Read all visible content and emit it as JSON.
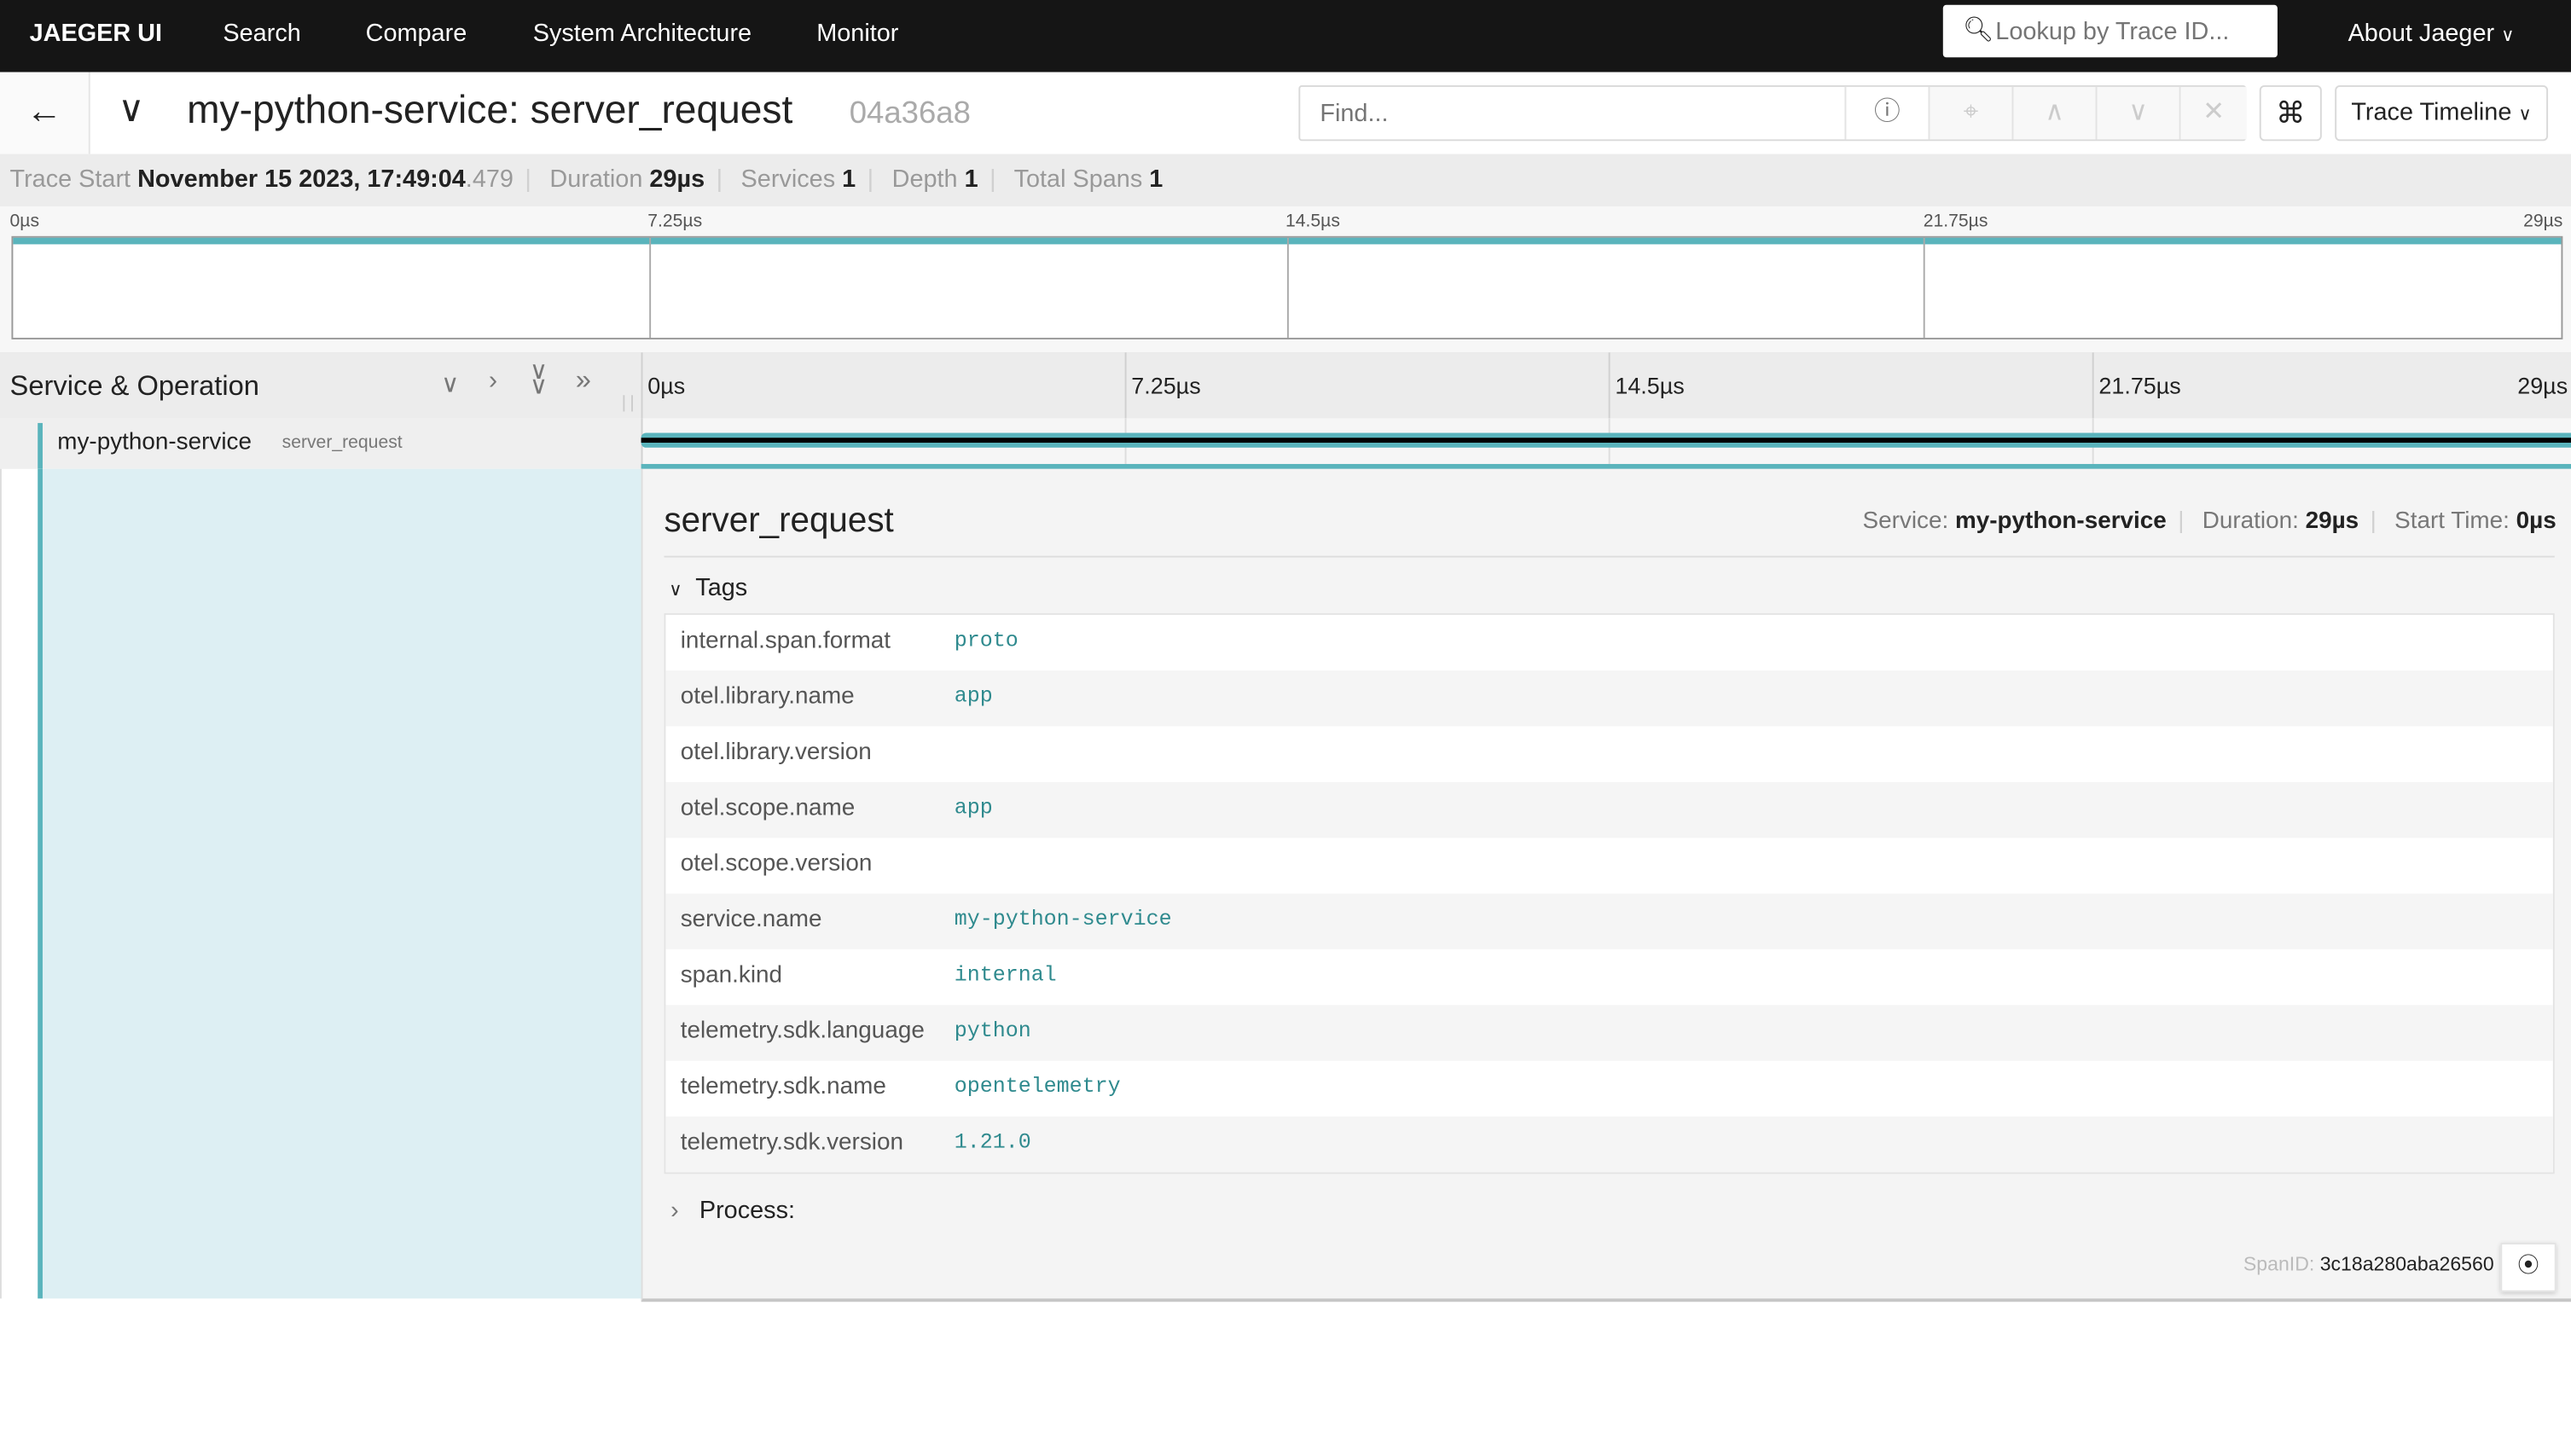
{
  "nav": {
    "brand": "JAEGER UI",
    "items": [
      "Search",
      "Compare",
      "System Architecture",
      "Monitor"
    ],
    "lookup_placeholder": "Lookup by Trace ID...",
    "about": "About Jaeger"
  },
  "trace": {
    "service": "my-python-service",
    "operation": "server_request",
    "title": "my-python-service: server_request",
    "trace_id_short": "04a36a8",
    "find_placeholder": "Find...",
    "view_mode": "Trace Timeline"
  },
  "info": {
    "start_label": "Trace Start",
    "start_value": "November 15 2023, 17:49:04",
    "start_ms": ".479",
    "duration_label": "Duration",
    "duration": "29µs",
    "services_label": "Services",
    "services": "1",
    "depth_label": "Depth",
    "depth": "1",
    "spans_label": "Total Spans",
    "spans": "1"
  },
  "ticks": [
    "0µs",
    "7.25µs",
    "14.5µs",
    "21.75µs",
    "29µs"
  ],
  "header": {
    "title": "Service & Operation"
  },
  "span": {
    "service": "my-python-service",
    "operation": "server_request",
    "start_fraction": 0,
    "duration_fraction": 1
  },
  "detail": {
    "title": "server_request",
    "service_label": "Service:",
    "service": "my-python-service",
    "duration_label": "Duration:",
    "duration": "29µs",
    "start_label": "Start Time:",
    "start": "0µs",
    "tags_label": "Tags",
    "process_label": "Process:",
    "spanid_label": "SpanID:",
    "spanid": "3c18a280aba26560",
    "tags": [
      {
        "k": "internal.span.format",
        "v": "proto"
      },
      {
        "k": "otel.library.name",
        "v": "app"
      },
      {
        "k": "otel.library.version",
        "v": ""
      },
      {
        "k": "otel.scope.name",
        "v": "app"
      },
      {
        "k": "otel.scope.version",
        "v": ""
      },
      {
        "k": "service.name",
        "v": "my-python-service"
      },
      {
        "k": "span.kind",
        "v": "internal"
      },
      {
        "k": "telemetry.sdk.language",
        "v": "python"
      },
      {
        "k": "telemetry.sdk.name",
        "v": "opentelemetry"
      },
      {
        "k": "telemetry.sdk.version",
        "v": "1.21.0"
      }
    ]
  },
  "colors": {
    "accent": "#5ab4bc",
    "nav": "#151515"
  }
}
